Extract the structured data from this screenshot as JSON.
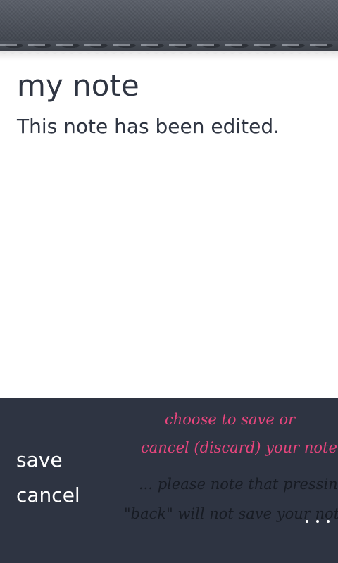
{
  "note": {
    "title": "my note",
    "body": "This note has been edited."
  },
  "app_bar": {
    "menu_items": [
      {
        "label": "save"
      },
      {
        "label": "cancel"
      }
    ],
    "more_icon": "ellipsis-icon"
  },
  "hint": {
    "line1": "choose to save or",
    "line2": "cancel (discard) your note",
    "line3": "... please note that pressing",
    "line4": "\"back\" will not save your note"
  },
  "colors": {
    "header": "#4a4f58",
    "app_bar": "#2e3442",
    "text": "#2f3542",
    "hint_accent": "#e7457d",
    "hint_dark": "#171b23"
  }
}
